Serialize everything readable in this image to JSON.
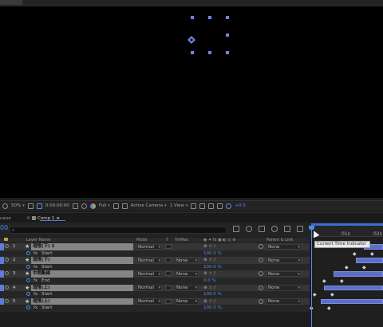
{
  "viewer": {
    "zoom": "50%",
    "timecode": "0:00:00:00",
    "resolution": "Full",
    "camera": "Active Camera",
    "views": "1 View",
    "exposure": "+0.0"
  },
  "panels": {
    "tab_left": "ueue",
    "tab_comp": "Comp 1",
    "comp_menu": "≡"
  },
  "timeline": {
    "timecode": "00",
    "search_placeholder": "",
    "ruler": [
      "01s",
      "02s"
    ],
    "tooltip": "Current Time Indicator",
    "columns": {
      "layer_name": "Layer Name",
      "mode": "Mode",
      "t": "T",
      "trkmat": "TrkMat",
      "parent": "Parent & Link"
    }
  },
  "rows": [
    {
      "kind": "layer",
      "num": "1",
      "name": "瑁愯(下) 2",
      "mode": "Normal",
      "matte": "",
      "parent": "None"
    },
    {
      "kind": "prop",
      "fx": "fx",
      "name": "Start",
      "value": "100.0 %"
    },
    {
      "kind": "layer",
      "num": "2",
      "name": "瑁愯(下)",
      "mode": "Normal",
      "matte": "None",
      "parent": "None"
    },
    {
      "kind": "prop",
      "fx": "fx",
      "name": "Start",
      "value": "100.0 %"
    },
    {
      "kind": "layer",
      "num": "3",
      "name": "中間斷線",
      "mode": "Normal",
      "matte": "None",
      "parent": "None"
    },
    {
      "kind": "prop",
      "fx": "fx",
      "name": "End",
      "value": "0.0 %"
    },
    {
      "kind": "layer",
      "num": "4",
      "name": "瑁愯(上)",
      "mode": "Normal",
      "matte": "None",
      "parent": "None"
    },
    {
      "kind": "prop",
      "fx": "fx",
      "name": "Start",
      "value": "100.0 %"
    },
    {
      "kind": "layer",
      "num": "5",
      "name": "瑁愯(上)",
      "mode": "Normal",
      "matte": "None",
      "parent": "None"
    },
    {
      "kind": "prop",
      "fx": "fx",
      "name": "Start",
      "value": "100.0 %"
    }
  ],
  "switch_glyphs": "⊕ ☆ /",
  "kf_glyph": "◆",
  "colors": {
    "accent": "#4d8ce8",
    "label": "#5b7fd8",
    "layer_bar": "#5c6fc8"
  }
}
